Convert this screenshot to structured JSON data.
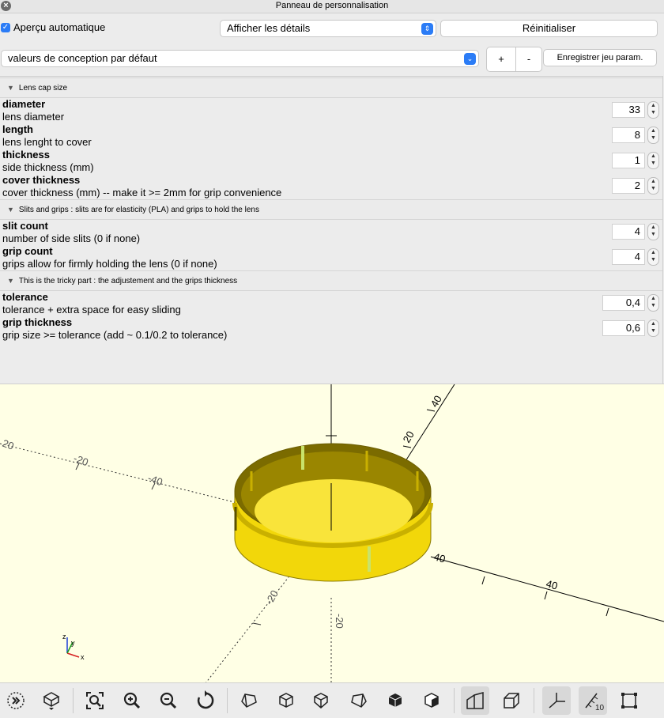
{
  "window": {
    "title": "Panneau de personnalisation"
  },
  "header": {
    "auto_preview_label": "Aperçu automatique",
    "details_select": "Afficher les détails",
    "reset_label": "Réinitialiser",
    "preset_select": "valeurs de conception par défaut",
    "plus_label": "+",
    "minus_label": "-",
    "save_preset_label": "Enregistrer jeu param."
  },
  "sections": [
    {
      "title": "Lens cap size",
      "params": [
        {
          "name": "diameter",
          "desc": "lens diameter",
          "value": "33"
        },
        {
          "name": "length",
          "desc": "lens lenght to cover",
          "value": "8"
        },
        {
          "name": "thickness",
          "desc": "side thickness (mm)",
          "value": "1"
        },
        {
          "name": "cover thickness",
          "desc": "cover thickness (mm)  -- make it >= 2mm for grip convenience",
          "value": "2"
        }
      ]
    },
    {
      "title": "Slits and grips : slits are for elasticity (PLA) and grips to hold the lens",
      "params": [
        {
          "name": "slit count",
          "desc": "number of side slits (0 if none)",
          "value": "4"
        },
        {
          "name": "grip count",
          "desc": "grips allow for firmly holding the lens (0 if none)",
          "value": "4"
        }
      ]
    },
    {
      "title": "This is the tricky part : the adjustement and the grips thickness",
      "params": [
        {
          "name": "tolerance",
          "desc": "tolerance + extra space for easy sliding",
          "value": "0,4"
        },
        {
          "name": "grip thickness",
          "desc": "grip size >= tolerance (add ~ 0.1/0.2 to tolerance)",
          "value": "0,6"
        }
      ]
    }
  ],
  "viewport": {
    "axis_labels": [
      "20",
      "40",
      "-20",
      "-40",
      "20",
      "-20",
      "40",
      "20",
      "-20",
      "-40"
    ],
    "orientation": {
      "x": "x",
      "y": "y",
      "z": "z"
    },
    "colors": {
      "background": "#ffffe5",
      "model": "#f2d70a",
      "model_dark": "#7a6a00"
    }
  },
  "toolbar": {
    "scale_label": "10",
    "tools": [
      "animate-icon",
      "render-icon",
      "view-all-icon",
      "zoom-in-icon",
      "zoom-out-icon",
      "reset-view-icon",
      "view-right-icon",
      "view-top-icon",
      "view-bottom-icon",
      "view-left-icon",
      "view-front-icon",
      "view-back-icon",
      "perspective-icon",
      "orthogonal-icon",
      "show-axes-icon",
      "show-scale-icon",
      "show-edges-icon"
    ]
  }
}
